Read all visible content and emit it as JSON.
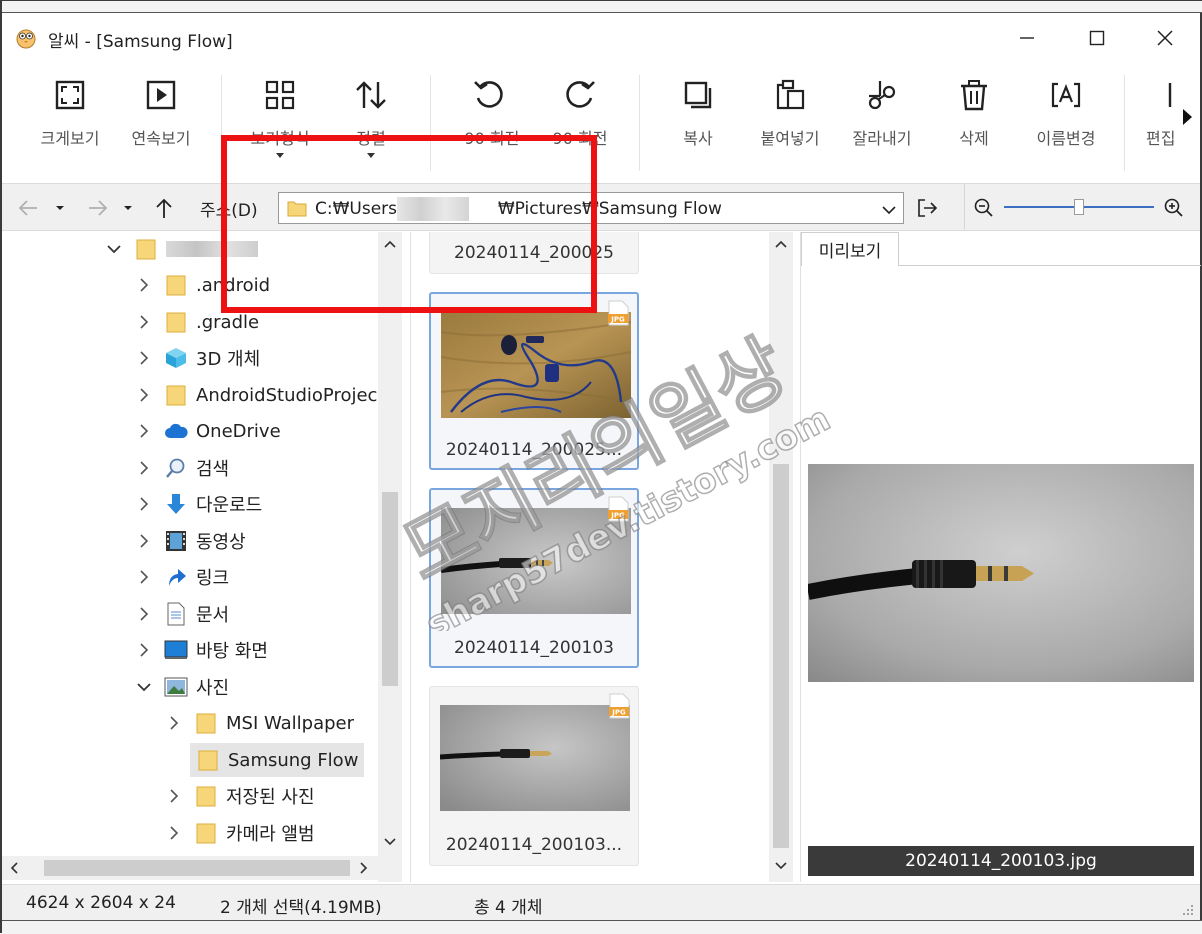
{
  "window": {
    "title": "알씨 - [Samsung Flow]",
    "controls": {
      "minimize": "—",
      "maximize": "☐",
      "close": "✕"
    }
  },
  "toolbar": {
    "buttons": [
      {
        "label": "크게보기",
        "icon": "fullscreen-icon"
      },
      {
        "label": "연속보기",
        "icon": "slideshow-icon"
      },
      {
        "label": "보기형식",
        "icon": "view-grid-icon",
        "dropdown": true
      },
      {
        "label": "정렬",
        "icon": "sort-icon",
        "dropdown": true
      },
      {
        "label": "-90 회전",
        "icon": "rotate-left-icon"
      },
      {
        "label": "90 회전",
        "icon": "rotate-right-icon"
      },
      {
        "label": "복사",
        "icon": "copy-icon"
      },
      {
        "label": "붙여넣기",
        "icon": "paste-icon"
      },
      {
        "label": "잘라내기",
        "icon": "cut-icon"
      },
      {
        "label": "삭제",
        "icon": "delete-icon"
      },
      {
        "label": "이름변경",
        "icon": "rename-icon"
      },
      {
        "label": "편집",
        "icon": "edit-icon"
      }
    ],
    "more_icon": "more-arrow-icon"
  },
  "addressbar": {
    "label": "주소(D)",
    "path_prefix": "C:₩Users₩",
    "path_suffix": "₩Pictures₩Samsung Flow"
  },
  "tree": {
    "items": [
      {
        "label": "",
        "icon": "folder-icon",
        "expanded": true,
        "level": 0,
        "blurred": true
      },
      {
        "label": ".android",
        "icon": "folder-icon",
        "level": 1
      },
      {
        "label": ".gradle",
        "icon": "folder-icon",
        "level": 1
      },
      {
        "label": "3D 개체",
        "icon": "3d-objects-icon",
        "level": 1
      },
      {
        "label": "AndroidStudioProjects",
        "icon": "folder-icon",
        "level": 1
      },
      {
        "label": "OneDrive",
        "icon": "cloud-icon",
        "level": 1
      },
      {
        "label": "검색",
        "icon": "search-icon",
        "level": 1
      },
      {
        "label": "다운로드",
        "icon": "download-icon",
        "level": 1
      },
      {
        "label": "동영상",
        "icon": "video-icon",
        "level": 1
      },
      {
        "label": "링크",
        "icon": "link-icon",
        "level": 1
      },
      {
        "label": "문서",
        "icon": "document-icon",
        "level": 1
      },
      {
        "label": "바탕 화면",
        "icon": "desktop-icon",
        "level": 1
      },
      {
        "label": "사진",
        "icon": "pictures-icon",
        "expanded": true,
        "level": 1
      },
      {
        "label": "MSI Wallpaper",
        "icon": "folder-icon",
        "level": 2
      },
      {
        "label": "Samsung Flow",
        "icon": "folder-icon",
        "level": 2,
        "selected": true
      },
      {
        "label": "저장된 사진",
        "icon": "folder-icon",
        "level": 2
      },
      {
        "label": "카메라 앨범",
        "icon": "folder-icon",
        "level": 2
      }
    ]
  },
  "thumbnails": [
    {
      "name": "20240114_200025",
      "selected": false,
      "partial": true
    },
    {
      "name": "20240114_200025...",
      "selected": true,
      "badge": "JPG"
    },
    {
      "name": "20240114_200103",
      "selected": true,
      "badge": "JPG"
    },
    {
      "name": "20240114_200103...",
      "selected": false,
      "badge": "JPG"
    }
  ],
  "preview": {
    "tab": "미리보기",
    "caption": "20240114_200103.jpg"
  },
  "statusbar": {
    "dimensions": "4624 x 2604 x 24",
    "selection": "2 개체 선택(4.19MB)",
    "total": "총 4 개체"
  },
  "watermark": {
    "line1": "모지리의일상",
    "line2": "sharp57dev.tistory.com"
  },
  "colors": {
    "accent": "#3c6fc2",
    "annotation": "#ee1111",
    "folder": "#f7d67a",
    "selection_border": "#7aa6e0"
  }
}
